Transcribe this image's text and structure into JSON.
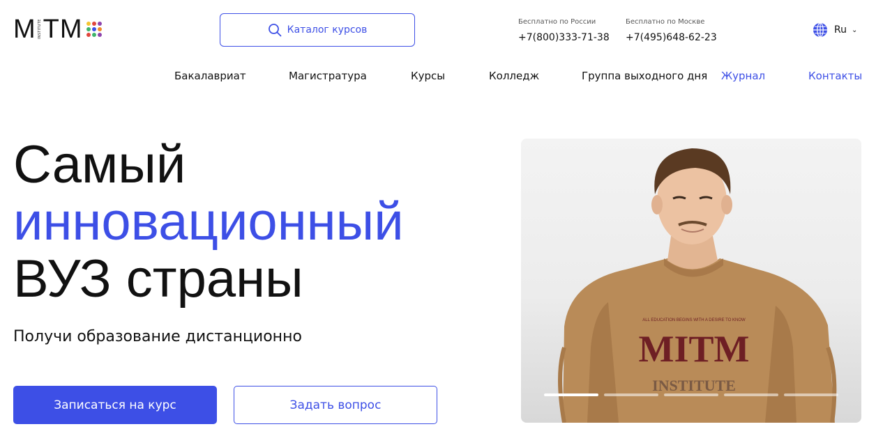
{
  "header": {
    "logo": {
      "text": "MITM",
      "sub": "INSTITUTE"
    },
    "catalog_label": "Каталог курсов",
    "phones": [
      {
        "label": "Бесплатно по России",
        "number": "+7(800)333-71-38"
      },
      {
        "label": "Бесплатно по Москве",
        "number": "+7(495)648-62-23"
      }
    ],
    "language": "Ru"
  },
  "nav": {
    "items": [
      {
        "label": "Бакалавриат"
      },
      {
        "label": "Магистратура"
      },
      {
        "label": "Курсы"
      },
      {
        "label": "Колледж"
      },
      {
        "label": "Группа выходного дня"
      },
      {
        "label": "Журнал"
      },
      {
        "label": "Контакты"
      }
    ]
  },
  "hero": {
    "title_line1": "Самый",
    "title_line2": "инновационный",
    "title_line3": "ВУЗ страны",
    "subtitle": "Получи образование дистанционно",
    "primary_button": "Записаться на курс",
    "secondary_button": "Задать вопрос"
  },
  "slider": {
    "sweatshirt_text": "MITM",
    "sweatshirt_sub": "INSTITUTE",
    "sweatshirt_small": "ALL EDUCATION BEGINS WITH A DESIRE TO KNOW",
    "slides_count": 5,
    "active_slide": 1
  },
  "colors": {
    "accent": "#3d4fe6",
    "text": "#111111",
    "logo_dots": [
      "#f4c531",
      "#e0463d",
      "#8e44ad",
      "#3db36b",
      "#3d4fe6",
      "#f08a2b",
      "#e0463d",
      "#3db36b",
      "#8e44ad"
    ]
  }
}
